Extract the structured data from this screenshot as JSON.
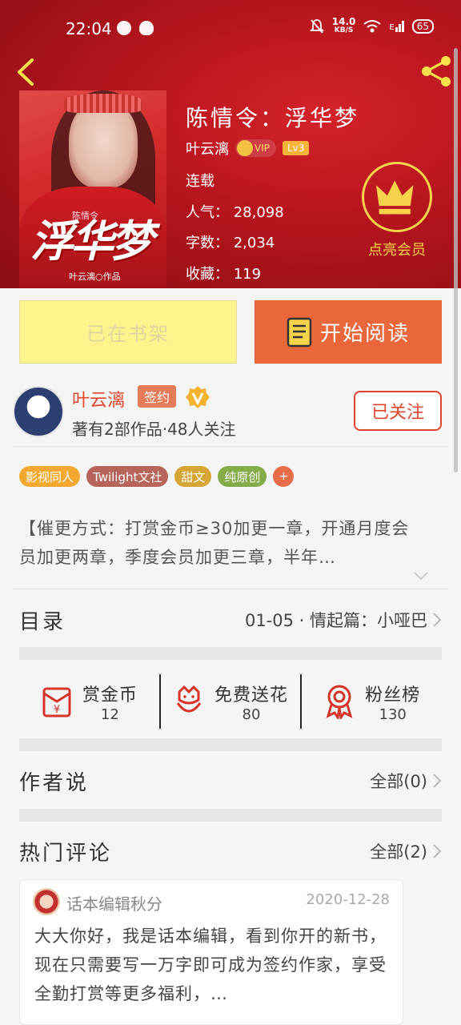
{
  "status_bar": {
    "time": "22:04",
    "net_speed_value": "14.0",
    "net_speed_unit": "KB/S",
    "network_type": "E",
    "battery": "65"
  },
  "book": {
    "title": "陈情令：浮华梦",
    "author": "叶云漓",
    "vip_label": "VIP",
    "level": "Lv3",
    "status": "连载",
    "popularity": "人气： 28,098",
    "word_count": "字数： 2,034",
    "favorites": "收藏： 119",
    "cover": {
      "small_text": "陈情令",
      "big_text": "浮华梦",
      "credit": "叶云漓○作品"
    }
  },
  "membership": {
    "label": "点亮会员"
  },
  "buttons": {
    "shelf": "已在书架",
    "read": "开始阅读"
  },
  "author": {
    "name": "叶云漓",
    "signed": "签约",
    "stats": "著有2部作品·48人关注",
    "follow": "已关注"
  },
  "tags": [
    {
      "label": "影视同人",
      "color": "#f3a92f"
    },
    {
      "label": "Twilight文社",
      "color": "#b7655a"
    },
    {
      "label": "甜文",
      "color": "#d7a534"
    },
    {
      "label": "纯原创",
      "color": "#84ad4a"
    }
  ],
  "tag_more": "+",
  "description": "【催更方式：打赏金币≥30加更一章，开通月度会员加更两章，季度会员加更三章，半年…",
  "catalog": {
    "title": "目录",
    "latest": "01-05 · 情起篇：小哑巴"
  },
  "stats": [
    {
      "icon": "red-envelope-icon",
      "label": "赏金币",
      "value": "12"
    },
    {
      "icon": "flower-icon",
      "label": "免费送花",
      "value": "80"
    },
    {
      "icon": "medal-icon",
      "label": "粉丝榜",
      "value": "130"
    }
  ],
  "author_says": {
    "title": "作者说",
    "all": "全部(0)"
  },
  "hot_comments": {
    "title": "热门评论",
    "all": "全部(2)",
    "items": [
      {
        "user": "话本编辑秋分",
        "date": "2020-12-28",
        "text": "大大你好，我是话本编辑，看到你开的新书，现在只需要写一万字即可成为签约作家，享受全勤打赏等更多福利，…"
      }
    ]
  },
  "colors": {
    "hero_red": "#b5151d",
    "accent_orange": "#e9673b",
    "shelf_yellow": "#fef48e",
    "author_red": "#e0452d",
    "gold": "#f7d24b"
  }
}
